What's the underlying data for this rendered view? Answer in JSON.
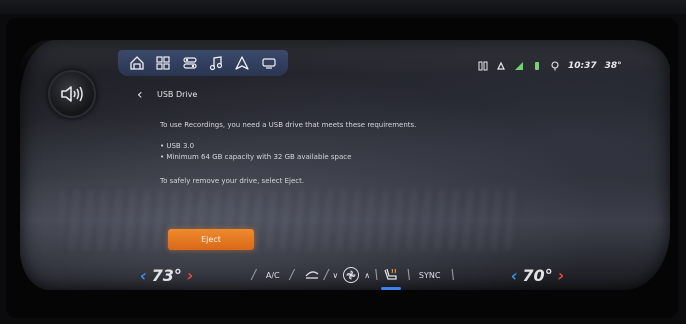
{
  "nav": {
    "apps": [
      "home-icon",
      "apps-grid-icon",
      "vehicle-settings-icon",
      "music-icon",
      "navigation-icon",
      "phone-projection-icon"
    ]
  },
  "status": {
    "icons": [
      "wireless-charging-icon",
      "bell-icon",
      "signal-icon",
      "battery-icon",
      "location-icon"
    ],
    "time": "10:37",
    "outside_temp": "38°"
  },
  "screen": {
    "title": "USB Drive",
    "intro": "To use Recordings, you need a USB drive that meets these requirements.",
    "requirements": [
      "• USB 3.0",
      "• Minimum 64 GB capacity with 32 GB available space"
    ],
    "remove_note": "To safely remove your drive, select Eject.",
    "eject_label": "Eject"
  },
  "climate": {
    "driver_temp": "73°",
    "passenger_temp": "70°",
    "ac_label": "A/C",
    "sync_label": "SYNC"
  },
  "colors": {
    "accent_orange": "#f08a2c",
    "temp_down": "#3f8df5",
    "temp_up": "#e8463a",
    "app_bar": "#34415f"
  }
}
